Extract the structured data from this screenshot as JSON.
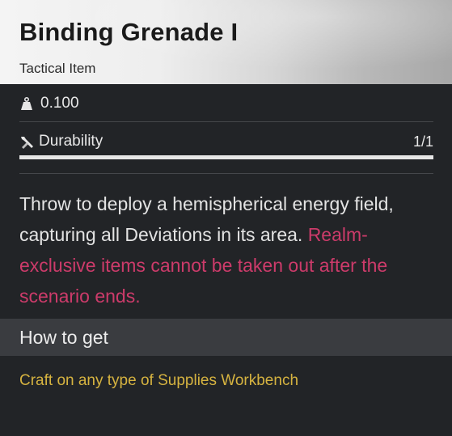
{
  "item": {
    "name": "Binding Grenade I",
    "category": "Tactical Item"
  },
  "stats": {
    "weight": "0.100",
    "weight_icon": "weight-icon",
    "durability_label": "Durability",
    "durability_value": "1/1",
    "durability_icon": "wrench-icon",
    "durability_fraction": 1.0
  },
  "description": {
    "text": "Throw to deploy a hemispherical energy field, capturing all Deviations in its area.",
    "warning": "Realm-exclusive items cannot be taken out after the scenario ends."
  },
  "how_to_get": {
    "heading": "How to get",
    "source": "Craft on any type of Supplies Workbench"
  },
  "colors": {
    "warning": "#cc3b6a",
    "source": "#d6b340",
    "panel": "#222427",
    "section_header": "#3a3c40"
  }
}
